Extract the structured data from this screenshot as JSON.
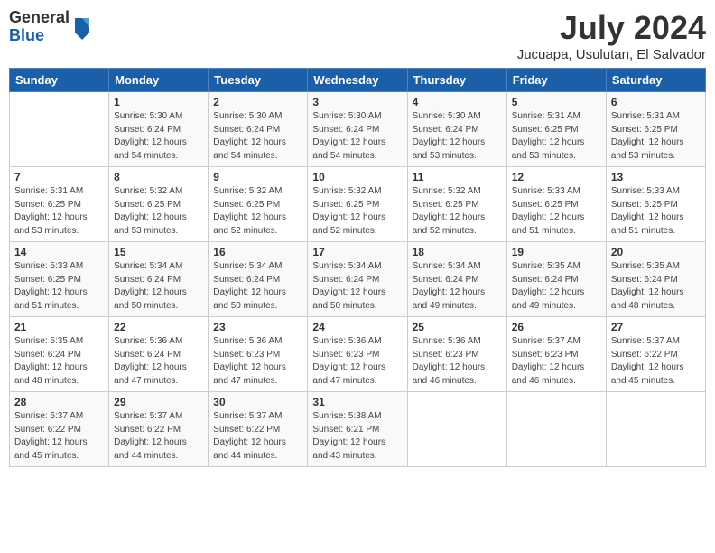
{
  "header": {
    "logo_general": "General",
    "logo_blue": "Blue",
    "month_title": "July 2024",
    "location": "Jucuapa, Usulutan, El Salvador"
  },
  "weekdays": [
    "Sunday",
    "Monday",
    "Tuesday",
    "Wednesday",
    "Thursday",
    "Friday",
    "Saturday"
  ],
  "weeks": [
    [
      {
        "day": "",
        "info": ""
      },
      {
        "day": "1",
        "info": "Sunrise: 5:30 AM\nSunset: 6:24 PM\nDaylight: 12 hours\nand 54 minutes."
      },
      {
        "day": "2",
        "info": "Sunrise: 5:30 AM\nSunset: 6:24 PM\nDaylight: 12 hours\nand 54 minutes."
      },
      {
        "day": "3",
        "info": "Sunrise: 5:30 AM\nSunset: 6:24 PM\nDaylight: 12 hours\nand 54 minutes."
      },
      {
        "day": "4",
        "info": "Sunrise: 5:30 AM\nSunset: 6:24 PM\nDaylight: 12 hours\nand 53 minutes."
      },
      {
        "day": "5",
        "info": "Sunrise: 5:31 AM\nSunset: 6:25 PM\nDaylight: 12 hours\nand 53 minutes."
      },
      {
        "day": "6",
        "info": "Sunrise: 5:31 AM\nSunset: 6:25 PM\nDaylight: 12 hours\nand 53 minutes."
      }
    ],
    [
      {
        "day": "7",
        "info": "Sunrise: 5:31 AM\nSunset: 6:25 PM\nDaylight: 12 hours\nand 53 minutes."
      },
      {
        "day": "8",
        "info": "Sunrise: 5:32 AM\nSunset: 6:25 PM\nDaylight: 12 hours\nand 53 minutes."
      },
      {
        "day": "9",
        "info": "Sunrise: 5:32 AM\nSunset: 6:25 PM\nDaylight: 12 hours\nand 52 minutes."
      },
      {
        "day": "10",
        "info": "Sunrise: 5:32 AM\nSunset: 6:25 PM\nDaylight: 12 hours\nand 52 minutes."
      },
      {
        "day": "11",
        "info": "Sunrise: 5:32 AM\nSunset: 6:25 PM\nDaylight: 12 hours\nand 52 minutes."
      },
      {
        "day": "12",
        "info": "Sunrise: 5:33 AM\nSunset: 6:25 PM\nDaylight: 12 hours\nand 51 minutes."
      },
      {
        "day": "13",
        "info": "Sunrise: 5:33 AM\nSunset: 6:25 PM\nDaylight: 12 hours\nand 51 minutes."
      }
    ],
    [
      {
        "day": "14",
        "info": "Sunrise: 5:33 AM\nSunset: 6:25 PM\nDaylight: 12 hours\nand 51 minutes."
      },
      {
        "day": "15",
        "info": "Sunrise: 5:34 AM\nSunset: 6:24 PM\nDaylight: 12 hours\nand 50 minutes."
      },
      {
        "day": "16",
        "info": "Sunrise: 5:34 AM\nSunset: 6:24 PM\nDaylight: 12 hours\nand 50 minutes."
      },
      {
        "day": "17",
        "info": "Sunrise: 5:34 AM\nSunset: 6:24 PM\nDaylight: 12 hours\nand 50 minutes."
      },
      {
        "day": "18",
        "info": "Sunrise: 5:34 AM\nSunset: 6:24 PM\nDaylight: 12 hours\nand 49 minutes."
      },
      {
        "day": "19",
        "info": "Sunrise: 5:35 AM\nSunset: 6:24 PM\nDaylight: 12 hours\nand 49 minutes."
      },
      {
        "day": "20",
        "info": "Sunrise: 5:35 AM\nSunset: 6:24 PM\nDaylight: 12 hours\nand 48 minutes."
      }
    ],
    [
      {
        "day": "21",
        "info": "Sunrise: 5:35 AM\nSunset: 6:24 PM\nDaylight: 12 hours\nand 48 minutes."
      },
      {
        "day": "22",
        "info": "Sunrise: 5:36 AM\nSunset: 6:24 PM\nDaylight: 12 hours\nand 47 minutes."
      },
      {
        "day": "23",
        "info": "Sunrise: 5:36 AM\nSunset: 6:23 PM\nDaylight: 12 hours\nand 47 minutes."
      },
      {
        "day": "24",
        "info": "Sunrise: 5:36 AM\nSunset: 6:23 PM\nDaylight: 12 hours\nand 47 minutes."
      },
      {
        "day": "25",
        "info": "Sunrise: 5:36 AM\nSunset: 6:23 PM\nDaylight: 12 hours\nand 46 minutes."
      },
      {
        "day": "26",
        "info": "Sunrise: 5:37 AM\nSunset: 6:23 PM\nDaylight: 12 hours\nand 46 minutes."
      },
      {
        "day": "27",
        "info": "Sunrise: 5:37 AM\nSunset: 6:22 PM\nDaylight: 12 hours\nand 45 minutes."
      }
    ],
    [
      {
        "day": "28",
        "info": "Sunrise: 5:37 AM\nSunset: 6:22 PM\nDaylight: 12 hours\nand 45 minutes."
      },
      {
        "day": "29",
        "info": "Sunrise: 5:37 AM\nSunset: 6:22 PM\nDaylight: 12 hours\nand 44 minutes."
      },
      {
        "day": "30",
        "info": "Sunrise: 5:37 AM\nSunset: 6:22 PM\nDaylight: 12 hours\nand 44 minutes."
      },
      {
        "day": "31",
        "info": "Sunrise: 5:38 AM\nSunset: 6:21 PM\nDaylight: 12 hours\nand 43 minutes."
      },
      {
        "day": "",
        "info": ""
      },
      {
        "day": "",
        "info": ""
      },
      {
        "day": "",
        "info": ""
      }
    ]
  ]
}
